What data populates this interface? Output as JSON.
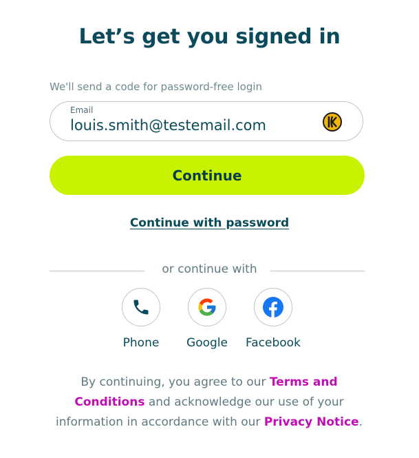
{
  "heading": "Let’s get you signed in",
  "hint": "We'll send a code for password-free login",
  "email": {
    "label": "Email",
    "value": "louis.smith@testemail.com",
    "icon": "keeper-icon"
  },
  "continue_label": "Continue",
  "password_link": "Continue with password",
  "divider": "or continue with",
  "social": [
    {
      "label": "Phone",
      "icon": "phone-icon"
    },
    {
      "label": "Google",
      "icon": "google-icon"
    },
    {
      "label": "Facebook",
      "icon": "facebook-icon"
    }
  ],
  "legal": {
    "prefix": "By continuing, you agree to our ",
    "terms": "Terms and Conditions",
    "middle": " and acknowledge our use of your information in accordance with our ",
    "privacy": "Privacy Notice",
    "suffix": "."
  },
  "colors": {
    "accent": "#c8f300",
    "text": "#0a4a5a",
    "link": "#c10db3"
  }
}
